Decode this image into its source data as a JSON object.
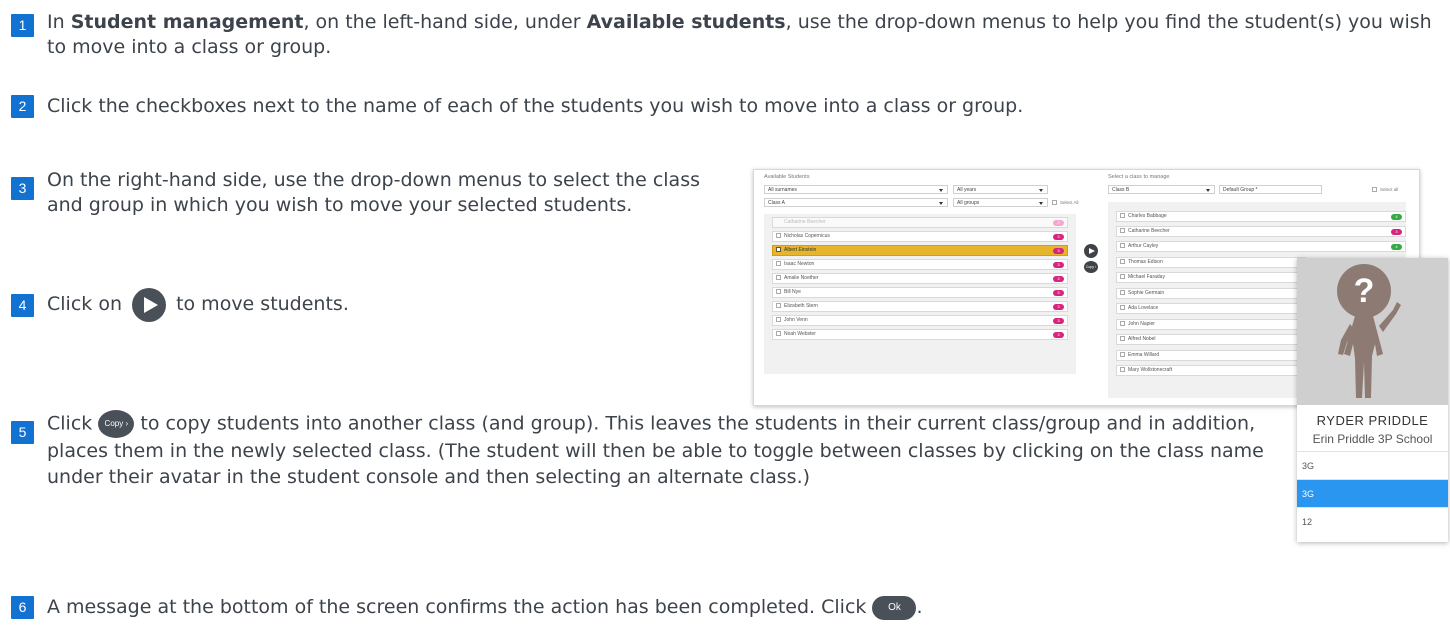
{
  "steps": [
    {
      "num": "1",
      "text_a": "In ",
      "bold_a": "Student management",
      "text_b": ", on the left-hand side, under ",
      "bold_b": "Available students",
      "text_c": ", use the drop-down menus to help you find the student(s) you wish to move into a class or group."
    },
    {
      "num": "2",
      "text": "Click the checkboxes next to the name of each of the students you wish to move into a class or group."
    },
    {
      "num": "3",
      "text": "On the right-hand side, use the drop-down menus to select the class and group in which you wish to move your selected students."
    },
    {
      "num": "4",
      "text_a": "Click on ",
      "text_b": " to move students."
    },
    {
      "num": "5",
      "text_a": "Click ",
      "copy_label": "Copy ›",
      "text_b": " to copy students into another class (and group). This leaves the students in their current class/group and in addition, places them in the newly selected class. (The student will then be able to toggle between classes by clicking on the class name under their avatar in the student console and then selecting an alternate class.)"
    },
    {
      "num": "6",
      "text_a": "A message at the bottom of the screen confirms the action has been completed. Click ",
      "ok_label": "Ok",
      "text_b": "."
    }
  ],
  "screenshot": {
    "available_title": "Available Students",
    "surname_filter": "All surnames",
    "year_filter": "All years",
    "class_filter": "Class A",
    "group_filter": "All groups",
    "select_all_left": "Select All",
    "left_students": [
      {
        "name": "Catharine Beecher",
        "badge": "2",
        "state": "faded"
      },
      {
        "name": "Nicholas Copernicus",
        "badge": "3",
        "state": "normal"
      },
      {
        "name": "Albert Einstein",
        "badge": "3",
        "state": "selected"
      },
      {
        "name": "Isaac Newton",
        "badge": "3",
        "state": "normal"
      },
      {
        "name": "Amalie Noether",
        "badge": "3",
        "state": "normal"
      },
      {
        "name": "Bill Nye",
        "badge": "3",
        "state": "normal"
      },
      {
        "name": "Elizabeth Stern",
        "badge": "3",
        "state": "normal"
      },
      {
        "name": "John Venn",
        "badge": "3",
        "state": "normal"
      },
      {
        "name": "Noah Webster",
        "badge": "3",
        "state": "normal"
      }
    ],
    "move_icon": "play-icon",
    "copy_label": "Copy ›",
    "manage_title": "Select a class to manage",
    "manage_class": "Class B",
    "manage_group": "Default Group *",
    "select_all_right": "Select all",
    "right_students": [
      {
        "name": "Charles Babbage",
        "badge": "4"
      },
      {
        "name": "Catharine Beecher",
        "badge": "3"
      },
      {
        "name": "Arthur Cayley",
        "badge": "4"
      },
      {
        "name": "Thomas Edison",
        "badge": ""
      },
      {
        "name": "Michael Faraday",
        "badge": ""
      },
      {
        "name": "Sophie Germain",
        "badge": ""
      },
      {
        "name": "Ada Lovelace",
        "badge": ""
      },
      {
        "name": "John Napier",
        "badge": ""
      },
      {
        "name": "Alfred Nobel",
        "badge": ""
      },
      {
        "name": "Emma Willard",
        "badge": ""
      },
      {
        "name": "Mary Wollstonecraft",
        "badge": ""
      }
    ],
    "colors": {
      "pink": "#d7247f",
      "green": "#33aa44",
      "selected": "#e7b52c"
    }
  },
  "avatar_card": {
    "name": "RYDER PRIDDLE",
    "school": "Erin Priddle 3P School",
    "classes": [
      "3G",
      "3G",
      "12"
    ],
    "active_index": 1,
    "avatar_icon": "question-mark-person-icon"
  },
  "colors": {
    "step_badge": "#1272d2",
    "text": "#3d434b",
    "button": "#4a5058",
    "active_class": "#2a96f0"
  }
}
